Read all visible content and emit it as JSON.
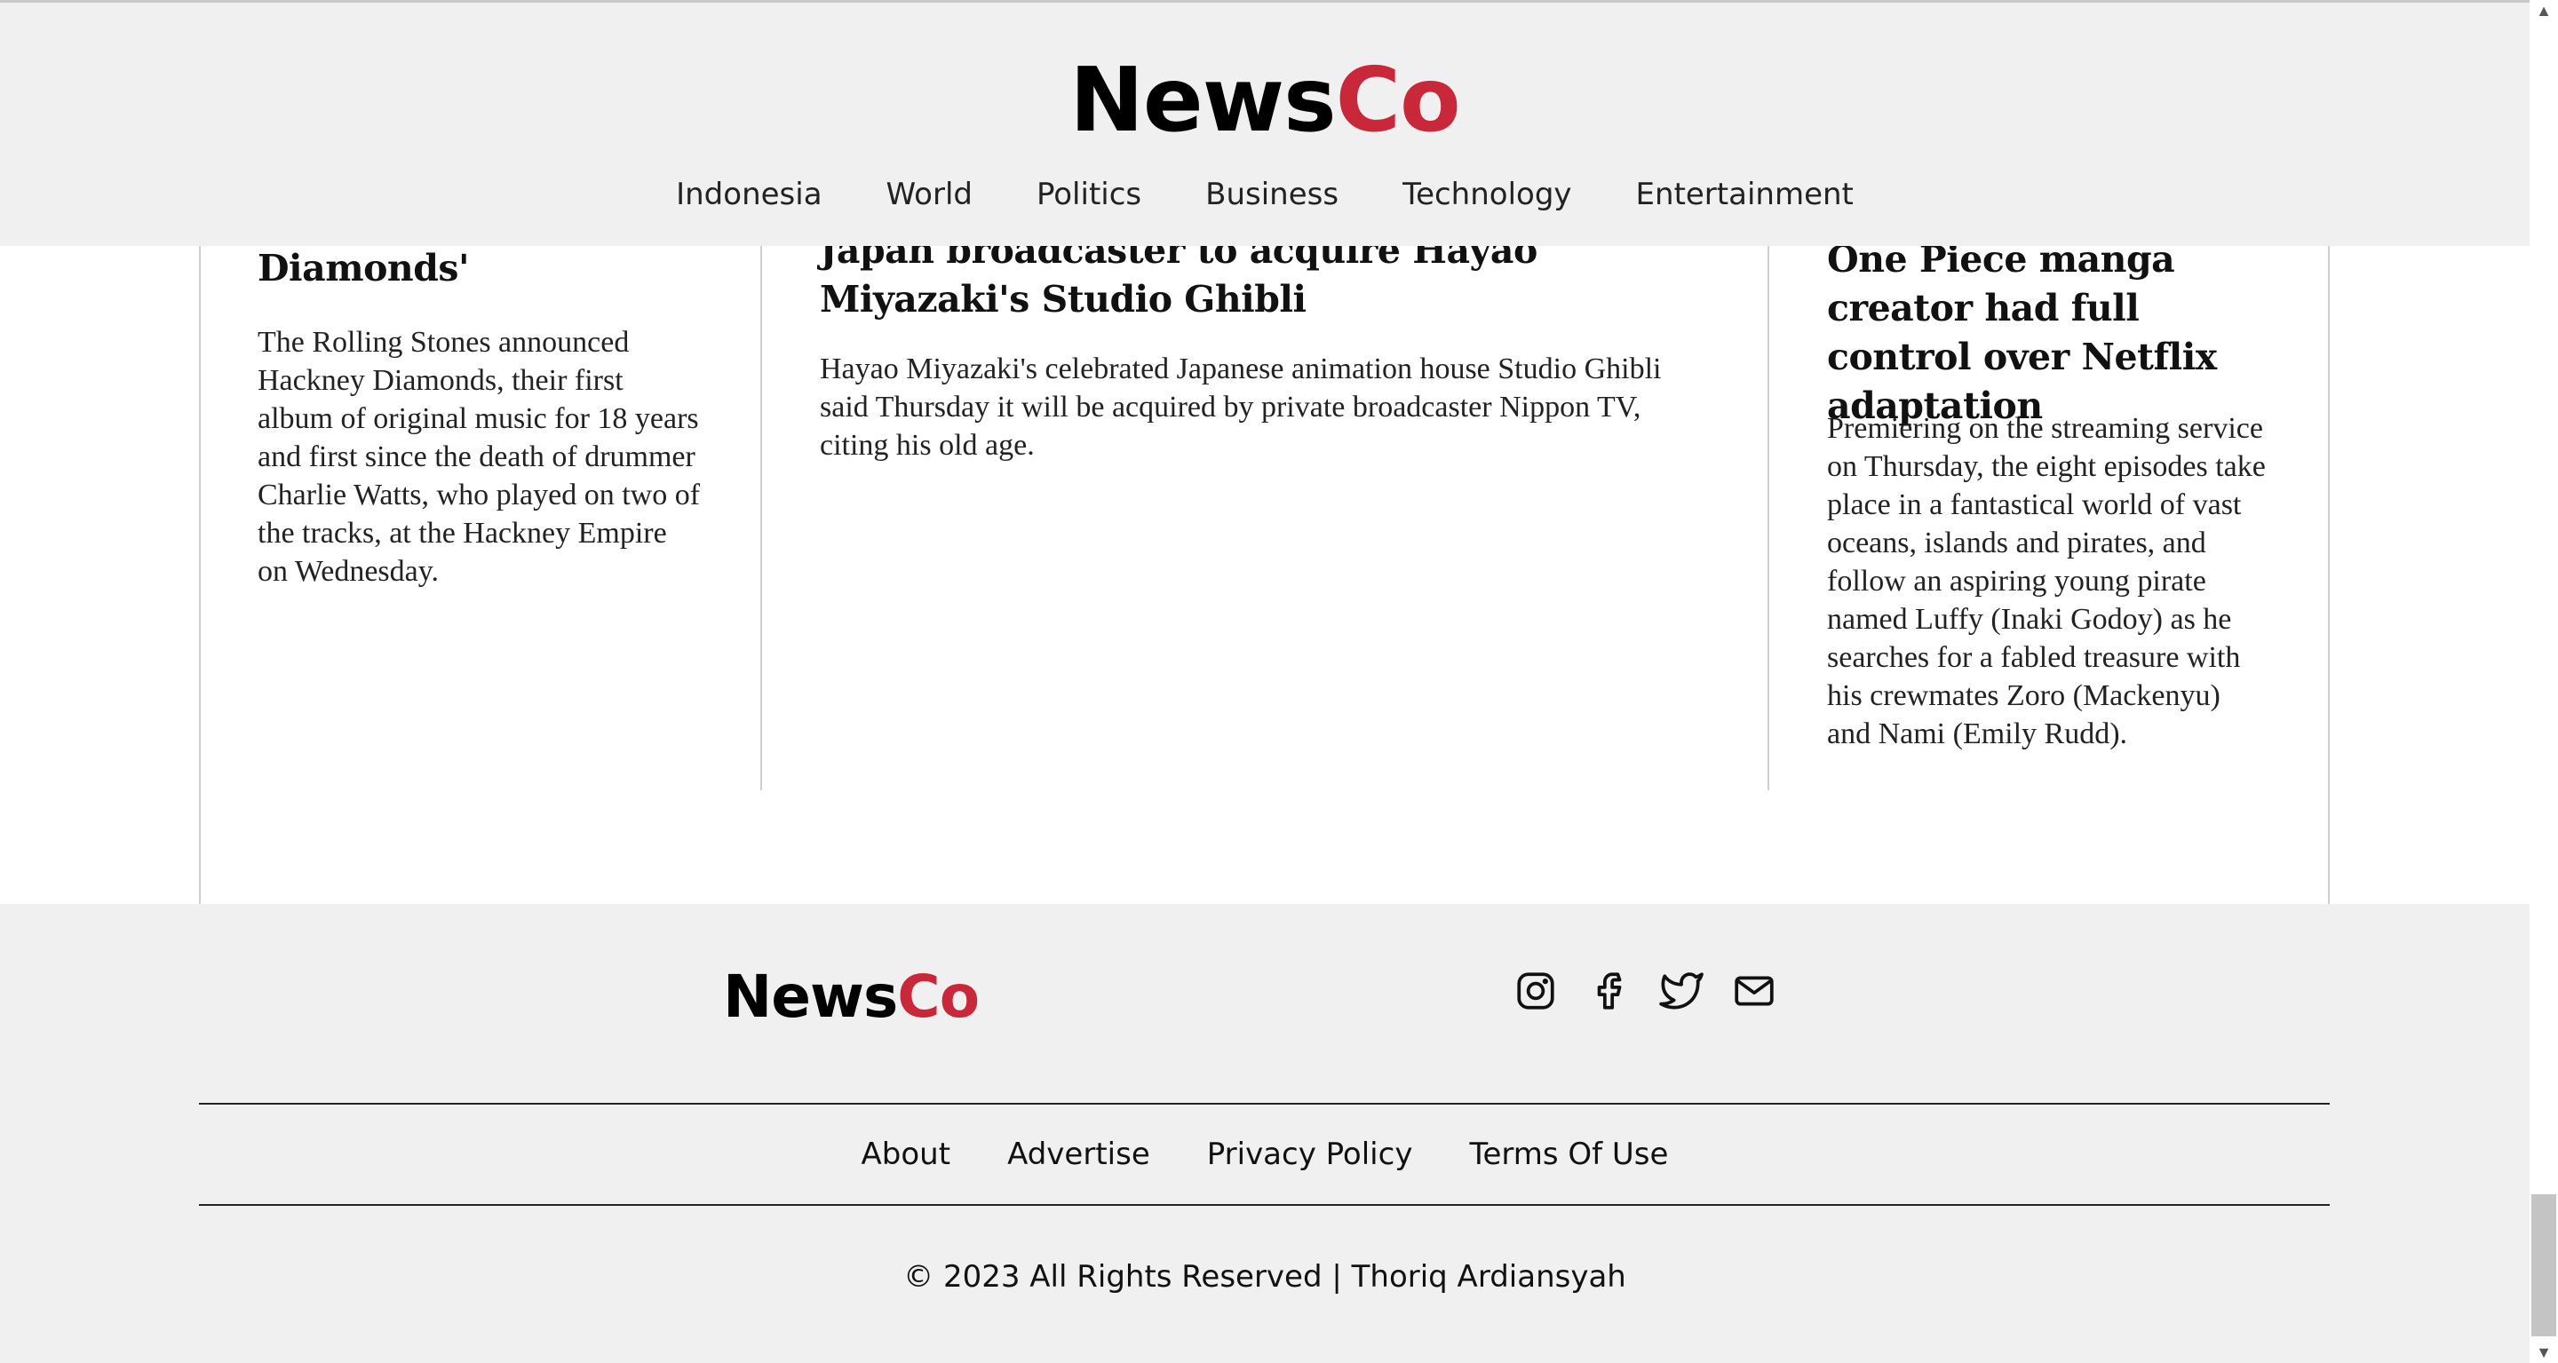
{
  "header": {
    "logo_news": "News",
    "logo_co": "Co",
    "nav": [
      "Indonesia",
      "World",
      "Politics",
      "Business",
      "Technology",
      "Entertainment"
    ]
  },
  "articles": [
    {
      "title": "Diamonds'",
      "body": "The Rolling Stones announced Hackney Diamonds, their first album of original music for 18 years and first since the death of drummer Charlie Watts, who played on two of the tracks, at the Hackney Empire on Wednesday."
    },
    {
      "title": "Japan broadcaster to acquire Hayao Miyazaki's Studio Ghibli",
      "body": "Hayao Miyazaki's celebrated Japanese animation house Studio Ghibli said Thursday it will be acquired by private broadcaster Nippon TV, citing his old age."
    },
    {
      "title": "One Piece manga creator had full control over Netflix adaptation",
      "body": "Premiering on the streaming service on Thursday, the eight episodes take place in a fantastical world of vast oceans, islands and pirates, and follow an aspiring young pirate named Luffy (Inaki Godoy) as he searches for a fabled treasure with his crewmates Zoro (Mackenyu) and Nami (Emily Rudd)."
    }
  ],
  "footer": {
    "logo_news": "News",
    "logo_co": "Co",
    "social_icons": [
      "instagram-icon",
      "facebook-icon",
      "twitter-icon",
      "mail-icon"
    ],
    "links": [
      "About",
      "Advertise",
      "Privacy Policy",
      "Terms Of Use"
    ],
    "copyright": "© 2023 All Rights Reserved | Thoriq Ardiansyah"
  },
  "colors": {
    "brand_red": "#c9283a",
    "header_bg": "#f0f0f0",
    "footer_bg": "#f0f0f0"
  }
}
